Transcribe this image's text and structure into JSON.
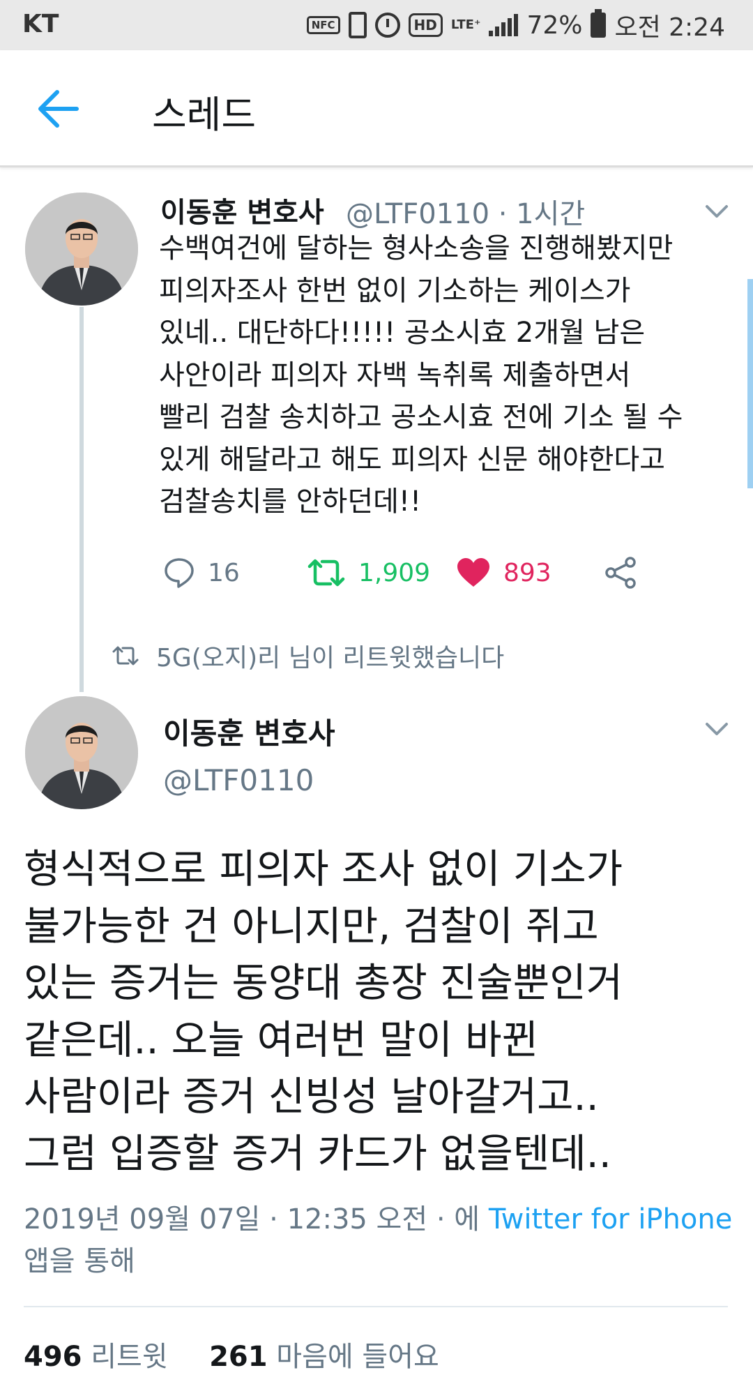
{
  "status_bar": {
    "carrier": "KT",
    "nfc": "NFC",
    "hd": "HD",
    "network": "LTE⁺",
    "battery": "72%",
    "time": "오전 2:24"
  },
  "header": {
    "title": "스레드"
  },
  "tweet1": {
    "name": "이동훈 변호사",
    "meta": "@LTF0110 · 1시간",
    "lines": [
      "수백여건에 달하는 형사소송을 진행해봤지만",
      "피의자조사 한번 없이 기소하는 케이스가",
      "있네.. 대단하다!!!!! 공소시효 2개월 남은",
      "사안이라 피의자 자백 녹취록 제출하면서",
      "빨리 검찰 송치하고 공소시효 전에 기소 될 수",
      "있게 해달라고 해도 피의자 신문 해야한다고",
      "검찰송치를 안하던데!!"
    ],
    "reply_count": "16",
    "retweet_count": "1,909",
    "like_count": "893"
  },
  "retweet_notice": "5G(오지)리 님이 리트윗했습니다",
  "tweet2": {
    "name": "이동훈 변호사",
    "handle": "@LTF0110",
    "lines": [
      "형식적으로 피의자 조사 없이 기소가",
      "불가능한 건 아니지만, 검찰이 쥐고",
      "있는 증거는 동양대 총장 진술뿐인거",
      "같은데.. 오늘 여러번 말이 바뀐",
      "사람이라 증거 신빙성 날아갈거고..",
      "그럼 입증할 증거 카드가 없을텐데.."
    ],
    "timestamp": "2019년 09월 07일 · 12:35 오전 · 에",
    "source_link": "Twitter for iPhone",
    "via_suffix": "앱을 통해",
    "retweets": "496",
    "retweets_label": "리트윗",
    "likes": "261",
    "likes_label": "마음에 들어요"
  },
  "colors": {
    "accent": "#1da1f2",
    "retweet_green": "#17bf63",
    "like_red": "#e0245e",
    "secondary_text": "#657786"
  }
}
